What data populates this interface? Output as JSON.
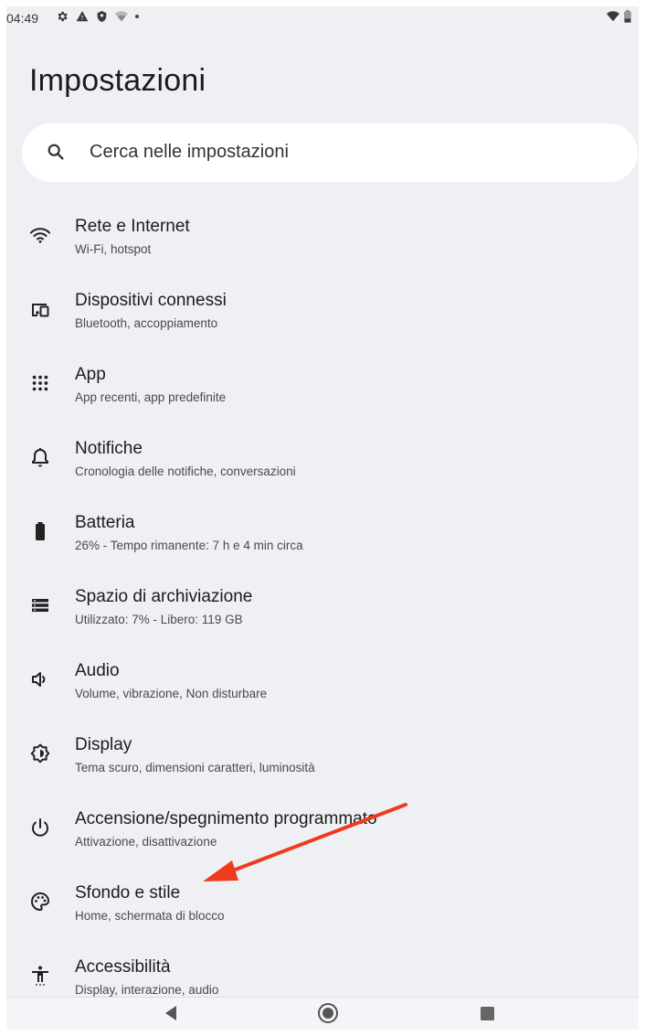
{
  "status_bar": {
    "time": "04:49"
  },
  "title": "Impostazioni",
  "search": {
    "placeholder": "Cerca nelle impostazioni"
  },
  "settings": [
    {
      "icon": "wifi-icon",
      "title": "Rete e Internet",
      "subtitle": "Wi-Fi, hotspot"
    },
    {
      "icon": "connected-devices-icon",
      "title": "Dispositivi connessi",
      "subtitle": "Bluetooth, accoppiamento"
    },
    {
      "icon": "apps-grid-icon",
      "title": "App",
      "subtitle": "App recenti, app predefinite"
    },
    {
      "icon": "bell-icon",
      "title": "Notifiche",
      "subtitle": "Cronologia delle notifiche, conversazioni"
    },
    {
      "icon": "battery-icon",
      "title": "Batteria",
      "subtitle": "26% - Tempo rimanente: 7 h e 4 min circa"
    },
    {
      "icon": "storage-icon",
      "title": "Spazio di archiviazione",
      "subtitle": "Utilizzato: 7% - Libero: 119 GB"
    },
    {
      "icon": "volume-icon",
      "title": "Audio",
      "subtitle": "Volume, vibrazione, Non disturbare"
    },
    {
      "icon": "brightness-icon",
      "title": "Display",
      "subtitle": "Tema scuro, dimensioni caratteri, luminosità"
    },
    {
      "icon": "power-icon",
      "title": "Accensione/spegnimento programmato",
      "subtitle": "Attivazione, disattivazione"
    },
    {
      "icon": "palette-icon",
      "title": "Sfondo e stile",
      "subtitle": "Home, schermata di blocco"
    },
    {
      "icon": "accessibility-icon",
      "title": "Accessibilità",
      "subtitle": "Display, interazione, audio"
    }
  ],
  "colors": {
    "background": "#eef0f4",
    "annotation_arrow": "#f03a1e"
  }
}
